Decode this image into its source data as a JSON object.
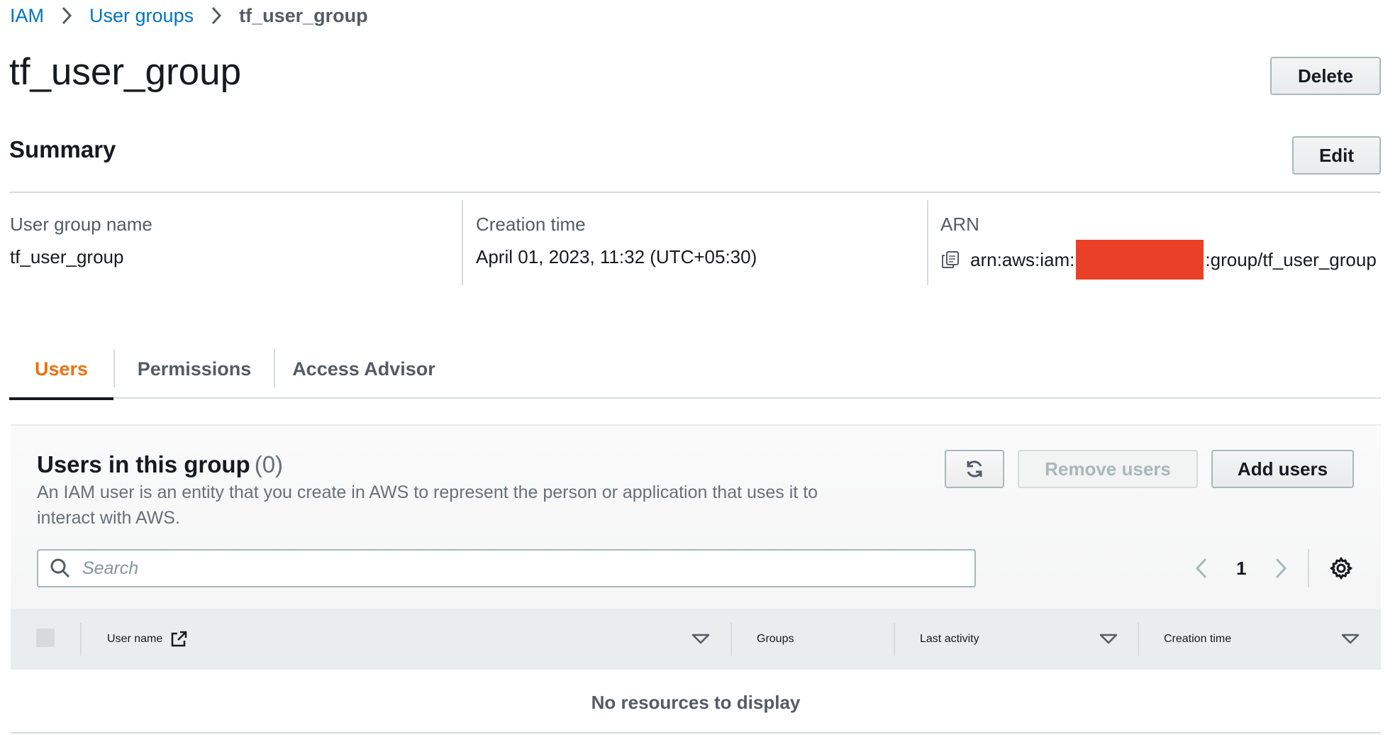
{
  "breadcrumb": {
    "items": [
      "IAM",
      "User groups"
    ],
    "current": "tf_user_group"
  },
  "page": {
    "title": "tf_user_group",
    "delete_label": "Delete"
  },
  "summary": {
    "title": "Summary",
    "edit_label": "Edit",
    "fields": [
      {
        "label": "User group name",
        "value": "tf_user_group"
      },
      {
        "label": "Creation time",
        "value": "April 01, 2023, 11:32 (UTC+05:30)"
      },
      {
        "label": "ARN",
        "value_prefix": "arn:aws:iam:",
        "value_suffix": ":group/tf_user_group"
      }
    ]
  },
  "tabs": [
    {
      "label": "Users",
      "active": true
    },
    {
      "label": "Permissions",
      "active": false
    },
    {
      "label": "Access Advisor",
      "active": false
    }
  ],
  "users_panel": {
    "title": "Users in this group",
    "count": "(0)",
    "description": "An IAM user is an entity that you create in AWS to represent the person or application that uses it to interact with AWS.",
    "remove_label": "Remove users",
    "add_label": "Add users",
    "search_placeholder": "Search",
    "page_number": "1",
    "columns": [
      "User name",
      "Groups",
      "Last activity",
      "Creation time"
    ],
    "empty_text": "No resources to display"
  },
  "colors": {
    "link": "#0073bb",
    "active_tab": "#ec7211",
    "redaction": "#e94027"
  }
}
